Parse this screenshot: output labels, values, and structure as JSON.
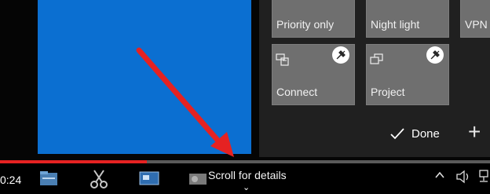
{
  "action_center": {
    "tiles": [
      {
        "label": "Priority only"
      },
      {
        "label": "Night light"
      },
      {
        "label": "VPN"
      },
      {
        "label": "Connect",
        "icon": "connect-icon"
      },
      {
        "label": "Project",
        "icon": "project-icon"
      }
    ],
    "done_label": "Done",
    "plus_label": "+"
  },
  "player": {
    "time": "0:24",
    "progress_fraction": 0.3,
    "scroll_hint": "Scroll for details",
    "chevron": "⌄"
  },
  "colors": {
    "desktop_blue": "#0b6fd1",
    "arrow_red": "#e52222",
    "progress_red": "#e52222"
  }
}
